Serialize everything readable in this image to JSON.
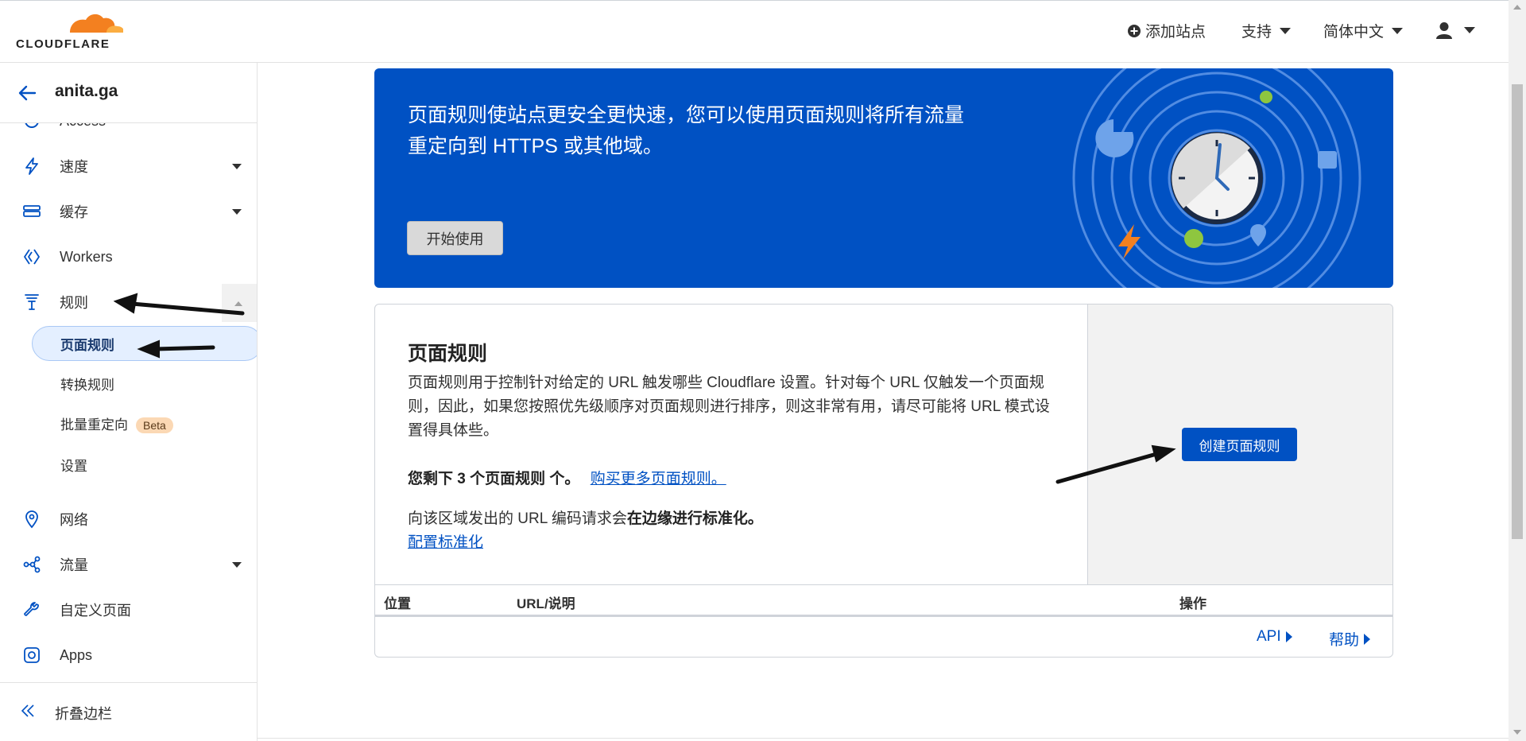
{
  "header": {
    "logo_text": "CLOUDFLARE",
    "add_site": "添加站点",
    "support": "支持",
    "language": "简体中文"
  },
  "sidebar": {
    "zone": "anita.ga",
    "partial_item": "Access",
    "items": [
      {
        "label": "速度"
      },
      {
        "label": "缓存"
      },
      {
        "label": "Workers"
      },
      {
        "label": "规则"
      },
      {
        "label": "网络"
      },
      {
        "label": "流量"
      },
      {
        "label": "自定义页面"
      },
      {
        "label": "Apps"
      }
    ],
    "sub_items": [
      {
        "label": "页面规则"
      },
      {
        "label": "转换规则"
      },
      {
        "label": "批量重定向"
      },
      {
        "label": "设置"
      }
    ],
    "beta_badge": "Beta",
    "collapse": "折叠边栏"
  },
  "banner": {
    "text_line1": "页面规则使站点更安全更快速，您可以使用页面规则将所有流量",
    "text_line2": "重定向到 HTTPS 或其他域。",
    "button": "开始使用"
  },
  "card": {
    "title": "页面规则",
    "description": "页面规则用于控制针对给定的 URL 触发哪些 Cloudflare 设置。针对每个 URL 仅触发一个页面规则，因此，如果您按照优先级顺序对页面规则进行排序，则这非常有用，请尽可能将 URL 模式设置得具体些。",
    "remaining_prefix": "您剩下 3 个页面规则 个。",
    "buy_more": "购买更多页面规则。",
    "normalize_prefix": "向该区域发出的 URL 编码请求会",
    "normalize_bold": "在边缘进行标准化。",
    "configure": "配置标准化",
    "create_button": "创建页面规则",
    "columns": [
      "位置",
      "URL/说明",
      "操作"
    ],
    "footer_api": "API",
    "footer_help": "帮助"
  },
  "colors": {
    "brand_blue": "#0051c3",
    "logo_orange": "#f38020",
    "beta_bg": "#fbd8b4"
  }
}
